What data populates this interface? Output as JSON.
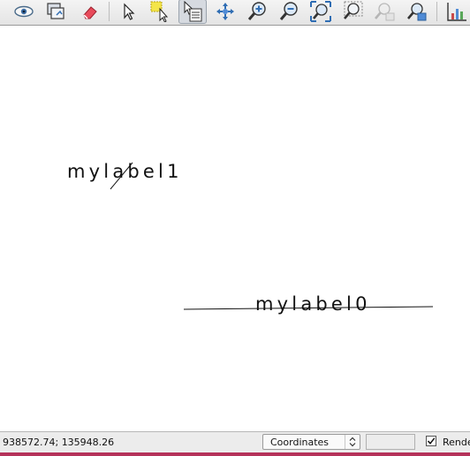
{
  "toolbar": {
    "buttons": [
      {
        "name": "eye-icon"
      },
      {
        "name": "layer-overview-icon"
      },
      {
        "name": "eraser-icon"
      },
      {
        "name": "select-arrow-icon"
      },
      {
        "name": "select-features-icon"
      },
      {
        "name": "identify-icon",
        "active": true
      },
      {
        "name": "pan-icon"
      },
      {
        "name": "zoom-in-icon"
      },
      {
        "name": "zoom-out-icon"
      },
      {
        "name": "zoom-full-icon"
      },
      {
        "name": "zoom-selection-icon"
      },
      {
        "name": "zoom-layer-icon"
      },
      {
        "name": "zoom-last-icon"
      },
      {
        "name": "chart-icon"
      }
    ]
  },
  "map": {
    "labels": [
      {
        "text": "mylabel1"
      },
      {
        "text": "mylabel0"
      }
    ]
  },
  "statusbar": {
    "coordinates": "938572.74; 135948.26",
    "mode_select": "Coordinates",
    "scale_value": "",
    "render_label": "Render",
    "render_checked": true
  },
  "colors": {
    "accent_bar": "#b5325a",
    "line_color": "#111111"
  }
}
